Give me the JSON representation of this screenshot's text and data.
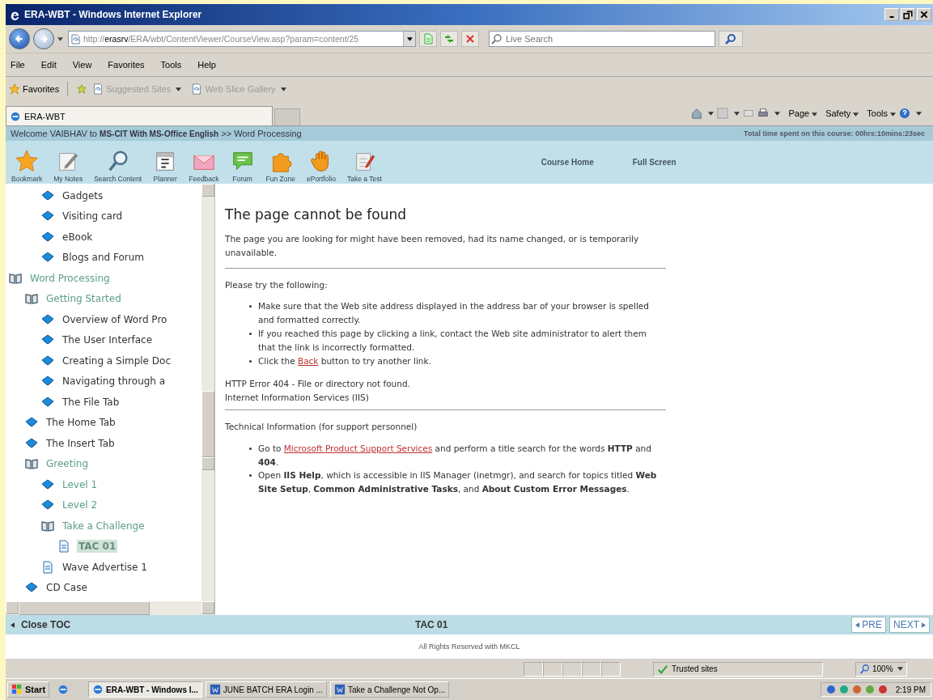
{
  "window": {
    "title": "ERA-WBT - Windows Internet Explorer"
  },
  "address_bar": {
    "url": "http://**erasrv**/ERA/wbt/ContentViewer/CourseView.asp?param=content/25",
    "search_placeholder": "Live Search"
  },
  "menu": [
    "File",
    "Edit",
    "View",
    "Favorites",
    "Tools",
    "Help"
  ],
  "favorites_bar": {
    "label": "Favorites",
    "links": [
      "Suggested Sites",
      "Web Slice Gallery"
    ]
  },
  "tab": {
    "title": "ERA-WBT"
  },
  "command_bar": [
    "Page",
    "Safety",
    "Tools"
  ],
  "course_header": {
    "welcome": "Welcome VAIBHAV to **MS-CIT With MS-Office English** >> Word Processing",
    "time_spent": "Total time spent on this course: 00hrs:10mins:23sec"
  },
  "toolbar": [
    {
      "label": "Bookmark",
      "kind": "star"
    },
    {
      "label": "My Notes",
      "kind": "note"
    },
    {
      "label": "Search Content",
      "kind": "search"
    },
    {
      "label": "Planner",
      "kind": "calendar"
    },
    {
      "label": "Feedback",
      "kind": "envelope"
    },
    {
      "label": "Forum",
      "kind": "chat"
    },
    {
      "label": "Fun Zone",
      "kind": "puzzle"
    },
    {
      "label": "ePortfolio",
      "kind": "hand"
    },
    {
      "label": "Take a Test",
      "kind": "test"
    }
  ],
  "header_links": [
    "Course Home",
    "Full Screen"
  ],
  "toc": {
    "items": [
      {
        "children": [
          {
            "children": [
              {
                "label": "Gadgets",
                "kind": "topic",
                "visited": false,
                "selected": false
              },
              {
                "label": "Visiting card",
                "kind": "topic",
                "visited": false,
                "selected": false
              },
              {
                "label": "eBook",
                "kind": "topic",
                "visited": false,
                "selected": false
              },
              {
                "label": "Blogs and Forum",
                "kind": "topic",
                "visited": false,
                "selected": false
              }
            ]
          }
        ]
      },
      {
        "label": "Word Processing",
        "kind": "folder",
        "expanded": true,
        "visited": true,
        "selected": false,
        "children": [
          {
            "label": "Getting Started",
            "kind": "folder",
            "expanded": true,
            "visited": true,
            "selected": false,
            "children": [
              {
                "label": "Overview of Word Pro",
                "kind": "topic",
                "visited": false,
                "selected": false
              },
              {
                "label": "The User Interface",
                "kind": "topic",
                "visited": false,
                "selected": false
              },
              {
                "label": "Creating a Simple Doc",
                "kind": "topic",
                "visited": false,
                "selected": false
              },
              {
                "label": "Navigating through a",
                "kind": "topic",
                "visited": false,
                "selected": false
              },
              {
                "label": "The File Tab",
                "kind": "topic",
                "visited": false,
                "selected": false
              }
            ]
          },
          {
            "label": "The Home Tab",
            "kind": "topic",
            "visited": false,
            "selected": false
          },
          {
            "label": "The Insert Tab",
            "kind": "topic",
            "visited": false,
            "selected": false
          },
          {
            "label": "Greeting",
            "kind": "folder",
            "expanded": true,
            "visited": true,
            "selected": false,
            "children": [
              {
                "label": "Level 1",
                "kind": "topic",
                "visited": true,
                "selected": false
              },
              {
                "label": "Level 2",
                "kind": "topic",
                "visited": true,
                "selected": false
              },
              {
                "label": "Take a Challenge",
                "kind": "folder",
                "expanded": true,
                "visited": true,
                "selected": false,
                "children": [
                  {
                    "label": "TAC 01",
                    "kind": "page",
                    "visited": false,
                    "selected": true
                  }
                ]
              },
              {
                "label": "Wave Advertise 1",
                "kind": "page",
                "visited": false,
                "selected": false
              }
            ]
          },
          {
            "label": "CD Case",
            "kind": "topic",
            "visited": false,
            "selected": false
          }
        ]
      }
    ]
  },
  "content": [
    {
      "kind": "heading",
      "text": "The page cannot be found"
    },
    {
      "kind": "paragraph",
      "text": "The page you are looking for might have been removed, had its name changed, or is temporarily unavailable."
    },
    {
      "kind": "rule"
    },
    {
      "kind": "paragraph",
      "text": "Please try the following:"
    },
    {
      "kind": "list",
      "items": [
        [
          {
            "text": "Make sure that the Web site address displayed in the address bar of your browser is spelled and formatted correctly."
          }
        ],
        [
          {
            "text": "If you reached this page by clicking a link, contact the Web site administrator to alert them that the link is incorrectly formatted."
          }
        ],
        [
          {
            "text": "Click the "
          },
          {
            "text": "Back",
            "link": true
          },
          {
            "text": " button to try another link."
          }
        ]
      ]
    },
    {
      "kind": "line",
      "text": "HTTP Error 404 - File or directory not found."
    },
    {
      "kind": "line",
      "text": "Internet Information Services (IIS)"
    },
    {
      "kind": "rule"
    },
    {
      "kind": "paragraph",
      "text": "Technical Information (for support personnel)"
    },
    {
      "kind": "list",
      "items": [
        [
          {
            "text": "Go to "
          },
          {
            "text": "Microsoft Product Support Services",
            "link": true
          },
          {
            "text": " and perform a title search for the words **HTTP** and **404**."
          }
        ],
        [
          {
            "text": "Open **IIS Help**, which is accessible in IIS Manager (inetmgr), and search for topics titled **Web Site Setup**, **Common Administrative Tasks**, and **About Custom Error Messages**."
          }
        ]
      ]
    }
  ],
  "nav_bar": {
    "close_toc": "Close TOC",
    "current": "TAC 01",
    "previous": "PRE",
    "next": "NEXT"
  },
  "footer": "All Rights Reserved with MKCL",
  "status_bar": {
    "zone": "Trusted sites",
    "zoom": "100%"
  },
  "taskbar": {
    "start": "Start",
    "tasks": [
      {
        "label": "ERA-WBT - Windows I...",
        "kind": "ie",
        "selected": true
      },
      {
        "label": "JUNE BATCH ERA Login ...",
        "kind": "word",
        "selected": false
      },
      {
        "label": "Take a Challenge Not Op...",
        "kind": "word",
        "selected": false
      }
    ],
    "time": "2:19 PM"
  }
}
